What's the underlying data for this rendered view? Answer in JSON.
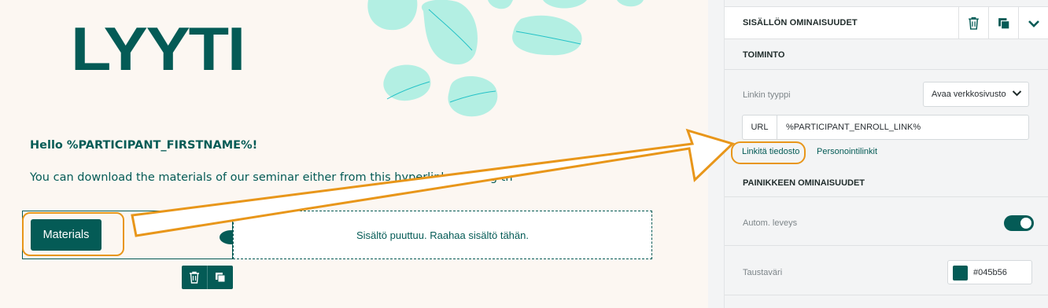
{
  "editor": {
    "logo": "LYYTI",
    "greeting": "Hello %PARTICIPANT_FIRSTNAME%!",
    "intro": "You can download the materials of our seminar either from this hyperlink or using th",
    "button_label": "Materials",
    "empty_block_text": "Sisältö puuttuu. Raahaa sisältö tähän.",
    "mini_toolbar": {
      "delete_icon": "trash-icon",
      "duplicate_icon": "copy-icon"
    }
  },
  "panel": {
    "title": "SISÄLLÖN OMINAISUUDET",
    "header_icons": [
      "trash-icon",
      "copy-icon",
      "chevron-down-icon"
    ],
    "action_section": "TOIMINTO",
    "link_type_label": "Linkin tyyppi",
    "link_type_value": "Avaa verkkosivusto",
    "url_label": "URL",
    "url_value": "%PARTICIPANT_ENROLL_LINK%",
    "link_file": "Linkitä tiedosto",
    "personal_links": "Personointilinkit",
    "button_section": "PAINIKKEEN OMINAISUUDET",
    "auto_width_label": "Autom. leveys",
    "auto_width_on": true,
    "bg_color_label": "Taustaväri",
    "bg_color_value": "#045b56"
  },
  "colors": {
    "brand": "#045b56",
    "canvas_bg": "#fcf7f2",
    "decor_leaf": "#b3efe3",
    "decor_vein": "#24c2c7",
    "annotation": "#e8961a"
  }
}
